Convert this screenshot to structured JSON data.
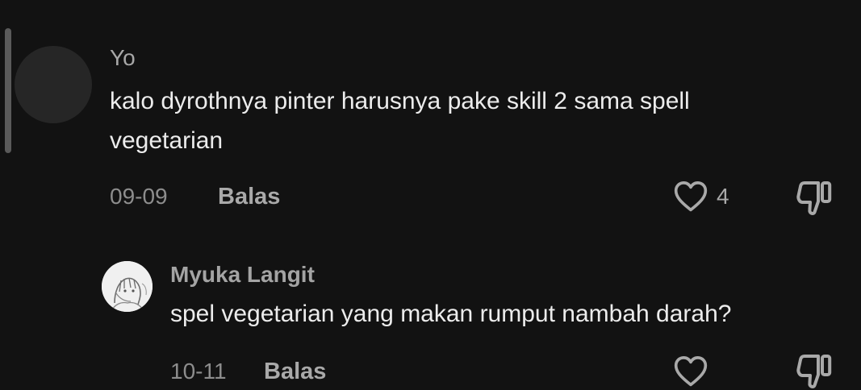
{
  "comment": {
    "username": "Yo",
    "text_line1": "kalo dyrothnya pinter harusnya pake skill 2 sama spell",
    "text_line2": "vegetarian",
    "date": "09-09",
    "reply_label": "Balas",
    "like_count": "4"
  },
  "reply": {
    "username": "Myuka Langit",
    "text": "spel vegetarian yang makan rumput nambah darah?",
    "date": "10-11",
    "reply_label": "Balas"
  },
  "icons": {
    "like": "heart-outline-icon",
    "dislike": "thumbs-down-icon"
  },
  "colors": {
    "background": "#121212",
    "primary_text": "#ececec",
    "secondary_text": "#a7a7a7",
    "meta_text": "#8d8d8d"
  }
}
